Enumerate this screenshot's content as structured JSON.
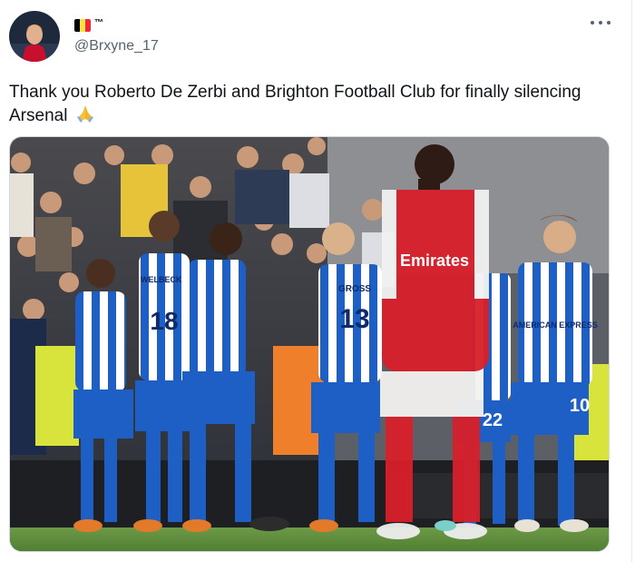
{
  "tweet": {
    "flag_colors": [
      "#000000",
      "#fae042",
      "#ed2939"
    ],
    "badge": "™",
    "handle": "@Brxyne_17",
    "text": "Thank you Roberto De Zerbi and Brighton Football Club for finally silencing Arsenal",
    "emoji": "folded-hands-emoji",
    "more_icon": "more-icon"
  },
  "photo": {
    "jersey_names": [
      "WELBECK",
      "GROSS"
    ],
    "jersey_numbers": [
      "18",
      "13",
      "22",
      "10"
    ],
    "sponsor": "Emirates",
    "sponsor_brighton": "AMERICAN EXPRESS",
    "colors": {
      "brighton_blue": "#1d5fc4",
      "arsenal_red": "#d81f2a",
      "pitch_green": "#5b8a3a"
    }
  }
}
